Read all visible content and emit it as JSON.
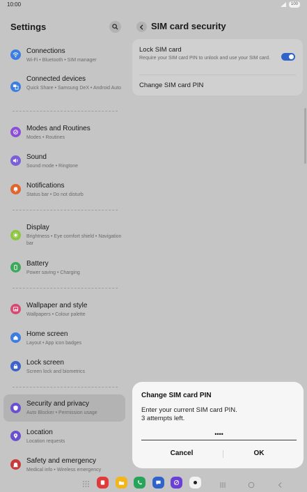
{
  "status_bar": {
    "time": "10:00",
    "battery": "100"
  },
  "settings": {
    "title": "Settings",
    "items": [
      {
        "title": "Connections",
        "subtitle": "Wi-Fi  •  Bluetooth  •  SIM manager",
        "icon": "wifi-icon",
        "color": "#3b7de1"
      },
      {
        "title": "Connected devices",
        "subtitle": "Quick Share  •  Samsung DeX  •  Android Auto",
        "icon": "devices-icon",
        "color": "#3b7de1"
      },
      {
        "title": "Modes and Routines",
        "subtitle": "Modes  •  Routines",
        "icon": "modes-icon",
        "color": "#8a4fd6"
      },
      {
        "title": "Sound",
        "subtitle": "Sound mode  •  Ringtone",
        "icon": "sound-icon",
        "color": "#7b5fd8"
      },
      {
        "title": "Notifications",
        "subtitle": "Status bar  •  Do not disturb",
        "icon": "bell-icon",
        "color": "#e0652e"
      },
      {
        "title": "Display",
        "subtitle": "Brightness  •  Eye comfort shield  •  Navigation bar",
        "icon": "display-icon",
        "color": "#8cc63f"
      },
      {
        "title": "Battery",
        "subtitle": "Power saving  •  Charging",
        "icon": "battery-icon",
        "color": "#3ca85a"
      },
      {
        "title": "Wallpaper and style",
        "subtitle": "Wallpapers  •  Colour palette",
        "icon": "wallpaper-icon",
        "color": "#d64a72"
      },
      {
        "title": "Home screen",
        "subtitle": "Layout  •  App icon badges",
        "icon": "home-icon",
        "color": "#3b7de1"
      },
      {
        "title": "Lock screen",
        "subtitle": "Screen lock and biometrics",
        "icon": "lock-icon",
        "color": "#3b63c9"
      },
      {
        "title": "Security and privacy",
        "subtitle": "Auto Blocker  •  Permission usage",
        "icon": "shield-icon",
        "color": "#6a4fd0"
      },
      {
        "title": "Location",
        "subtitle": "Location requests",
        "icon": "location-icon",
        "color": "#6a4fd0"
      },
      {
        "title": "Safety and emergency",
        "subtitle": "Medical info  •  Wireless emergency",
        "icon": "emergency-icon",
        "color": "#c93a3a"
      }
    ]
  },
  "sim_security": {
    "title": "SIM card security",
    "lock_sim": {
      "title": "Lock SIM card",
      "description": "Require your SIM card PIN to unlock and use your SIM card.",
      "enabled": true
    },
    "change_pin": "Change SIM card PIN"
  },
  "dialog": {
    "title": "Change SIM card PIN",
    "message_line1": "Enter your current SIM card PIN.",
    "message_line2": "3 attempts left.",
    "pin_value": "••••",
    "cancel_label": "Cancel",
    "ok_label": "OK"
  },
  "colors": {
    "accent": "#2f63c9",
    "background": "#c5c5c5",
    "selected": "#b3b3b3"
  }
}
